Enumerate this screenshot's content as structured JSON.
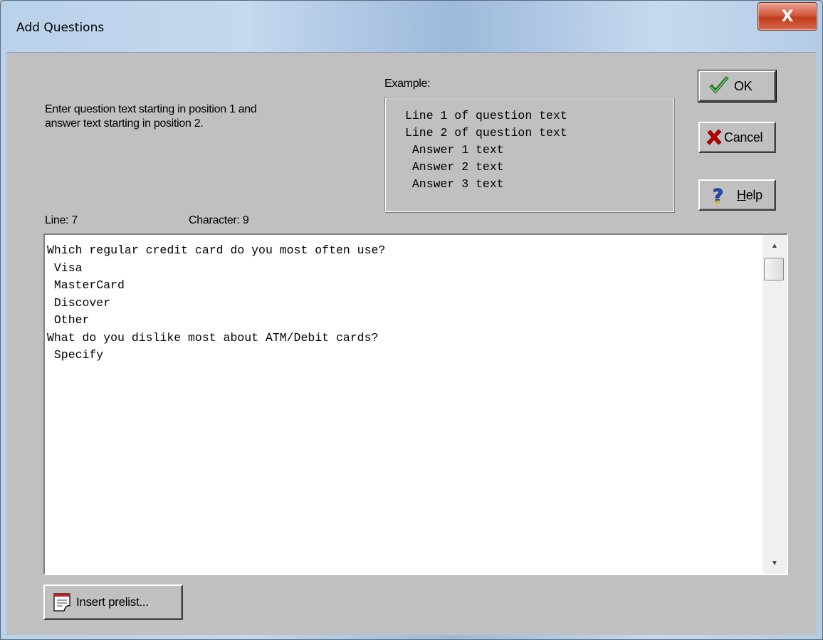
{
  "window": {
    "title": "Add Questions",
    "close_glyph": "X"
  },
  "instructions": {
    "text": "Enter question text starting in position 1 and\nanswer text starting in position 2."
  },
  "example": {
    "label": "Example:",
    "lines": [
      "Line 1 of question text",
      "Line 2 of question text",
      " Answer 1 text",
      " Answer 2 text",
      " Answer 3 text"
    ]
  },
  "buttons": {
    "ok": {
      "label": "OK",
      "icon": "checkmark-icon",
      "icon_color": "#2e8b2e"
    },
    "cancel": {
      "label": "Cancel",
      "icon": "red-x-icon",
      "icon_color": "#c00000"
    },
    "help": {
      "label": "Help",
      "mnemonic": "H",
      "label_rest": "elp",
      "icon": "question-mark-icon",
      "icon_color": "#2050c0"
    },
    "insert_prelist": {
      "label": "Insert prelist...",
      "icon": "document-icon"
    }
  },
  "status": {
    "line": "Line: 7",
    "character": "Character: 9"
  },
  "editor": {
    "lines": [
      "Which regular credit card do you most often use?",
      " Visa",
      " MasterCard",
      " Discover",
      " Other",
      "What do you dislike most about ATM/Debit cards?",
      " Specify"
    ]
  }
}
